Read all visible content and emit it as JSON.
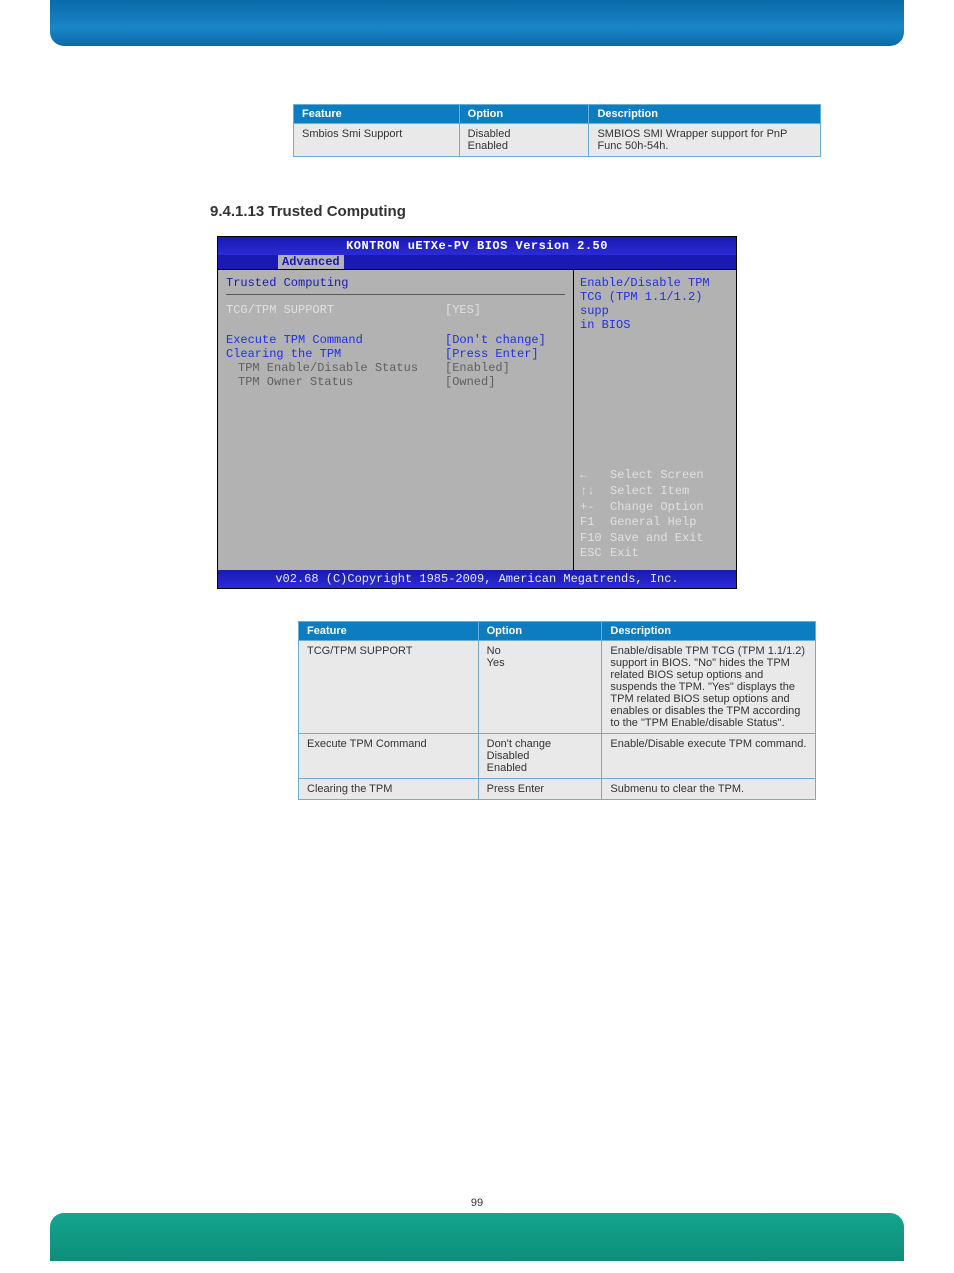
{
  "table1": {
    "headers": [
      "Feature",
      "Option",
      "Description"
    ],
    "rows": [
      {
        "feature": "Smbios Smi Support",
        "options": [
          "Disabled",
          "Enabled"
        ],
        "desc": "SMBIOS SMI Wrapper support for PnP Func 50h-54h."
      }
    ]
  },
  "section_heading": "9.4.1.13 Trusted Computing",
  "bios": {
    "title": "KONTRON uETXe-PV BIOS Version 2.50",
    "tab": "Advanced",
    "group": "Trusted Computing",
    "items": [
      {
        "label": "TCG/TPM SUPPORT",
        "value": "[YES]",
        "style": "active"
      },
      {
        "label": "",
        "value": "",
        "style": "gap"
      },
      {
        "label": "Execute TPM Command",
        "value": "[Don't change]",
        "style": "normal"
      },
      {
        "label": "Clearing the TPM",
        "value": "[Press Enter]",
        "style": "normal"
      },
      {
        "label": "TPM Enable/Disable Status",
        "value": "[Enabled]",
        "style": "dim"
      },
      {
        "label": "TPM Owner Status",
        "value": "[Owned]",
        "style": "dim"
      }
    ],
    "help": "Enable/Disable TPM\nTCG (TPM 1.1/1.2) supp\nin BIOS",
    "hints": [
      {
        "key": "←",
        "label": "Select Screen"
      },
      {
        "key": "↑↓",
        "label": "Select Item"
      },
      {
        "key": "+-",
        "label": "Change Option"
      },
      {
        "key": "F1",
        "label": "General Help"
      },
      {
        "key": "F10",
        "label": "Save and Exit"
      },
      {
        "key": "ESC",
        "label": "Exit"
      }
    ],
    "footer": "v02.68 (C)Copyright 1985-2009, American Megatrends, Inc."
  },
  "table2": {
    "headers": [
      "Feature",
      "Option",
      "Description"
    ],
    "rows": [
      {
        "feature": "TCG/TPM SUPPORT",
        "options": [
          "No",
          "Yes"
        ],
        "desc": "Enable/disable TPM TCG (TPM 1.1/1.2) support in BIOS. \"No\" hides the TPM related BIOS setup options and suspends the TPM. \"Yes\" displays the TPM related BIOS setup options and enables or disables the TPM according to the \"TPM Enable/disable Status\"."
      },
      {
        "feature": "Execute TPM Command",
        "options": [
          "Don't change",
          "Disabled",
          "Enabled"
        ],
        "desc": "Enable/Disable execute TPM command."
      },
      {
        "feature": "Clearing the TPM",
        "options": [
          "Press Enter"
        ],
        "desc": "Submenu to clear the TPM."
      }
    ]
  },
  "page_number": "99"
}
